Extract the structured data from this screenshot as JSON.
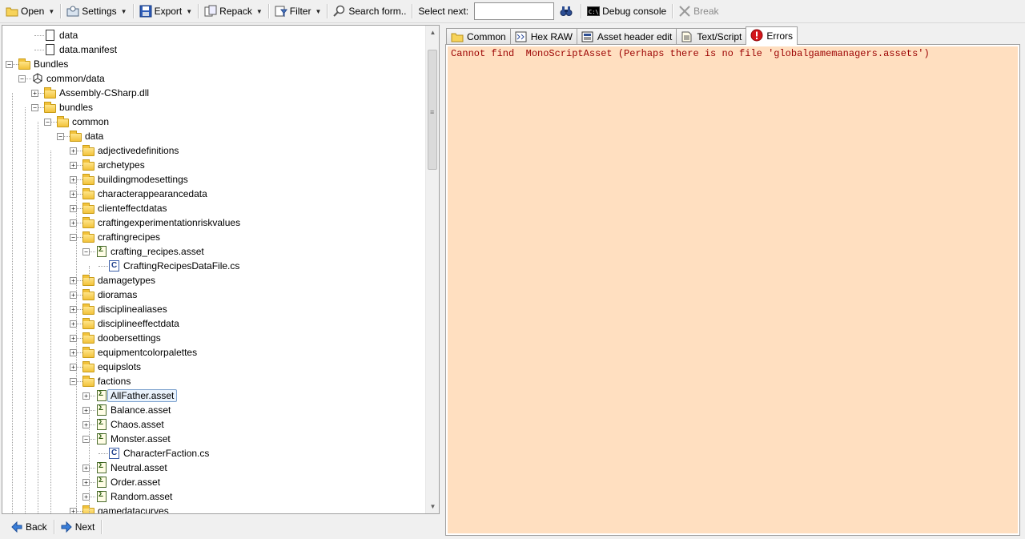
{
  "toolbar": {
    "open": "Open",
    "settings": "Settings",
    "export": "Export",
    "repack": "Repack",
    "filter": "Filter",
    "search_form": "Search form..",
    "select_next_label": "Select next:",
    "select_next_value": "",
    "debug_console": "Debug console",
    "break": "Break"
  },
  "tree": [
    {
      "label": "data",
      "icon": "file",
      "level": 2,
      "expander": null
    },
    {
      "label": "data.manifest",
      "icon": "file",
      "level": 2,
      "expander": null
    },
    {
      "label": "Bundles",
      "icon": "folder",
      "level": 0,
      "expander": "minus"
    },
    {
      "label": "common/data",
      "icon": "unity",
      "level": 1,
      "expander": "minus"
    },
    {
      "label": "Assembly-CSharp.dll",
      "icon": "folder",
      "level": 2,
      "expander": "plus"
    },
    {
      "label": "bundles",
      "icon": "folder",
      "level": 2,
      "expander": "minus"
    },
    {
      "label": "common",
      "icon": "folder",
      "level": 3,
      "expander": "minus"
    },
    {
      "label": "data",
      "icon": "folder",
      "level": 4,
      "expander": "minus"
    },
    {
      "label": "adjectivedefinitions",
      "icon": "folder",
      "level": 5,
      "expander": "plus"
    },
    {
      "label": "archetypes",
      "icon": "folder",
      "level": 5,
      "expander": "plus"
    },
    {
      "label": "buildingmodesettings",
      "icon": "folder",
      "level": 5,
      "expander": "plus"
    },
    {
      "label": "characterappearancedata",
      "icon": "folder",
      "level": 5,
      "expander": "plus"
    },
    {
      "label": "clienteffectdatas",
      "icon": "folder",
      "level": 5,
      "expander": "plus"
    },
    {
      "label": "craftingexperimentationriskvalues",
      "icon": "folder",
      "level": 5,
      "expander": "plus"
    },
    {
      "label": "craftingrecipes",
      "icon": "folder",
      "level": 5,
      "expander": "minus"
    },
    {
      "label": "crafting_recipes.asset",
      "icon": "asset",
      "level": 6,
      "expander": "minus"
    },
    {
      "label": "CraftingRecipesDataFile.cs",
      "icon": "cs",
      "level": 7,
      "expander": null
    },
    {
      "label": "damagetypes",
      "icon": "folder",
      "level": 5,
      "expander": "plus"
    },
    {
      "label": "dioramas",
      "icon": "folder",
      "level": 5,
      "expander": "plus"
    },
    {
      "label": "disciplinealiases",
      "icon": "folder",
      "level": 5,
      "expander": "plus"
    },
    {
      "label": "disciplineeffectdata",
      "icon": "folder",
      "level": 5,
      "expander": "plus"
    },
    {
      "label": "doobersettings",
      "icon": "folder",
      "level": 5,
      "expander": "plus"
    },
    {
      "label": "equipmentcolorpalettes",
      "icon": "folder",
      "level": 5,
      "expander": "plus"
    },
    {
      "label": "equipslots",
      "icon": "folder",
      "level": 5,
      "expander": "plus"
    },
    {
      "label": "factions",
      "icon": "folder",
      "level": 5,
      "expander": "minus"
    },
    {
      "label": "AllFather.asset",
      "icon": "asset",
      "level": 6,
      "expander": "plus",
      "selected": true
    },
    {
      "label": "Balance.asset",
      "icon": "asset",
      "level": 6,
      "expander": "plus"
    },
    {
      "label": "Chaos.asset",
      "icon": "asset",
      "level": 6,
      "expander": "plus"
    },
    {
      "label": "Monster.asset",
      "icon": "asset",
      "level": 6,
      "expander": "minus"
    },
    {
      "label": "CharacterFaction.cs",
      "icon": "cs",
      "level": 7,
      "expander": null
    },
    {
      "label": "Neutral.asset",
      "icon": "asset",
      "level": 6,
      "expander": "plus"
    },
    {
      "label": "Order.asset",
      "icon": "asset",
      "level": 6,
      "expander": "plus"
    },
    {
      "label": "Random.asset",
      "icon": "asset",
      "level": 6,
      "expander": "plus"
    },
    {
      "label": "gamedatacurves",
      "icon": "folder",
      "level": 5,
      "expander": "plus"
    }
  ],
  "nav": {
    "back": "Back",
    "next": "Next"
  },
  "tabs": [
    {
      "label": "Common",
      "icon": "folder-icon"
    },
    {
      "label": "Hex RAW",
      "icon": "hex-icon"
    },
    {
      "label": "Asset header edit",
      "icon": "header-edit-icon"
    },
    {
      "label": "Text/Script",
      "icon": "text-script-icon"
    },
    {
      "label": "Errors",
      "icon": "error-icon",
      "active": true
    }
  ],
  "errors": {
    "message": "Cannot find  MonoScriptAsset (Perhaps there is no file 'globalgamemanagers.assets')"
  },
  "colors": {
    "error_bg": "#ffdfc0",
    "error_text": "#9b0000",
    "selection": "#eaf3fd"
  }
}
